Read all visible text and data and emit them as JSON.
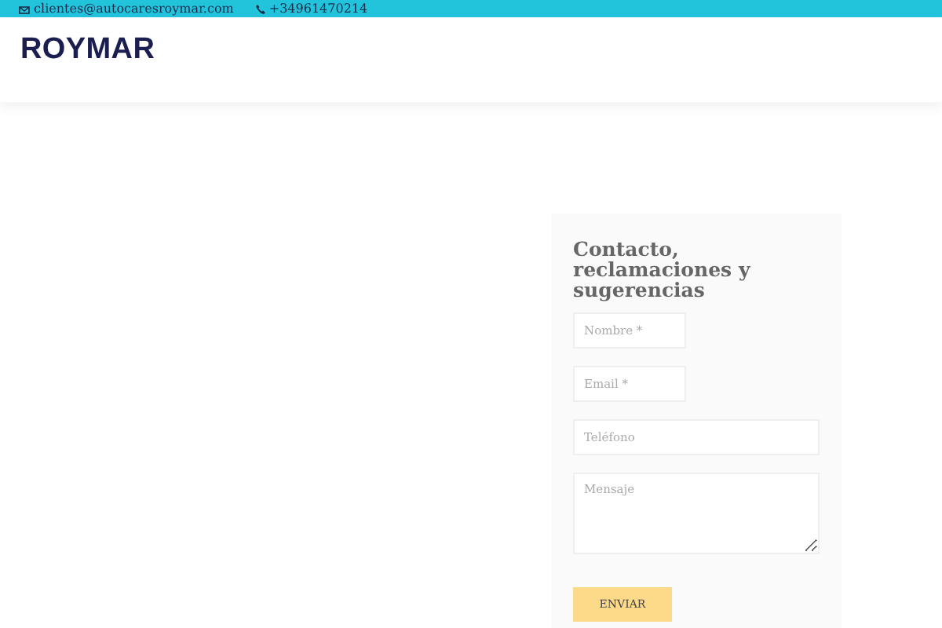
{
  "topbar": {
    "email": "clientes@autocaresroymar.com",
    "phone": "+34961470214"
  },
  "header": {
    "logo": "ROYMAR"
  },
  "contact_form": {
    "title": "Contacto, reclamaciones y sugerencias",
    "fields": [
      {
        "kind": "short",
        "placeholder": "Nombre *"
      },
      {
        "kind": "short",
        "placeholder": "Email *"
      },
      {
        "kind": "wide",
        "placeholder": "Teléfono"
      },
      {
        "kind": "area",
        "placeholder": "Mensaje"
      }
    ],
    "submit": "ENVIAR"
  }
}
